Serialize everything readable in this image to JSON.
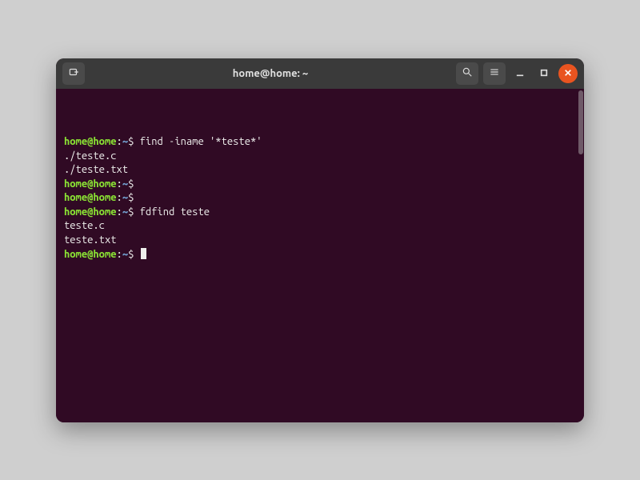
{
  "window": {
    "title": "home@home: ~"
  },
  "titlebar": {
    "icons": {
      "new_tab": "new-tab-icon",
      "search": "search-icon",
      "menu": "hamburger-icon",
      "minimize": "minimize-icon",
      "maximize": "maximize-icon",
      "close": "close-icon"
    }
  },
  "prompt": {
    "user_host": "home@home",
    "sep": ":",
    "path": "~",
    "symbol": "$"
  },
  "session": [
    {
      "type": "cmd",
      "text": "find -iname '*teste*'"
    },
    {
      "type": "out",
      "text": "./teste.c"
    },
    {
      "type": "out",
      "text": "./teste.txt"
    },
    {
      "type": "cmd",
      "text": ""
    },
    {
      "type": "cmd",
      "text": ""
    },
    {
      "type": "cmd",
      "text": "fdfind teste"
    },
    {
      "type": "out",
      "text": "teste.c"
    },
    {
      "type": "out",
      "text": "teste.txt"
    },
    {
      "type": "cmd",
      "text": "",
      "cursor": true
    }
  ],
  "colors": {
    "bg": "#300a24",
    "titlebar": "#3a3a3a",
    "prompt_user": "#8ae234",
    "prompt_path": "#729fcf",
    "text": "#eeeeec",
    "close_btn": "#e95420"
  }
}
